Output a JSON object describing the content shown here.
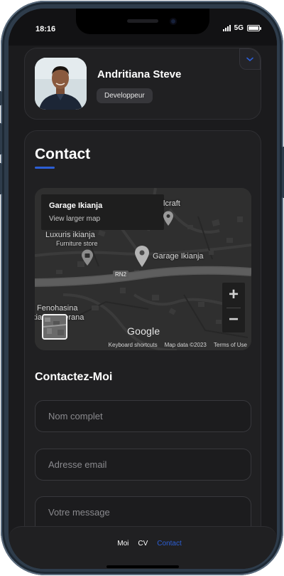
{
  "status_bar": {
    "time": "18:16",
    "network": "5G"
  },
  "profile": {
    "name": "Andritiana Steve",
    "role": "Developpeur",
    "toggle_icon": "chevron-down-icon"
  },
  "contact": {
    "title": "Contact",
    "map": {
      "info_title": "Garage Ikianja",
      "info_link": "View larger map",
      "labels": {
        "craft": "lcraft",
        "luxuris": "Luxuris ikianja",
        "furniture": "Furniture store",
        "garage": "Garage Ikianja",
        "road": "RN2",
        "fenohasina": "Fenohasina",
        "ederana": "kianja Ederana"
      },
      "zoom_in": "+",
      "zoom_out": "−",
      "google": "Google",
      "attribution": {
        "shortcuts": "Keyboard shortcuts",
        "map_data": "Map data ©2023",
        "terms": "Terms of Use"
      }
    },
    "form": {
      "title": "Contactez-Moi",
      "name_placeholder": "Nom complet",
      "email_placeholder": "Adresse email",
      "message_placeholder": "Votre message"
    }
  },
  "nav": {
    "items": [
      {
        "label": "Moi"
      },
      {
        "label": "CV"
      },
      {
        "label": "Contact"
      }
    ],
    "active": "Contact"
  },
  "colors": {
    "accent": "#2c5fd6",
    "background": "#1b1b1d",
    "card": "#202022"
  }
}
